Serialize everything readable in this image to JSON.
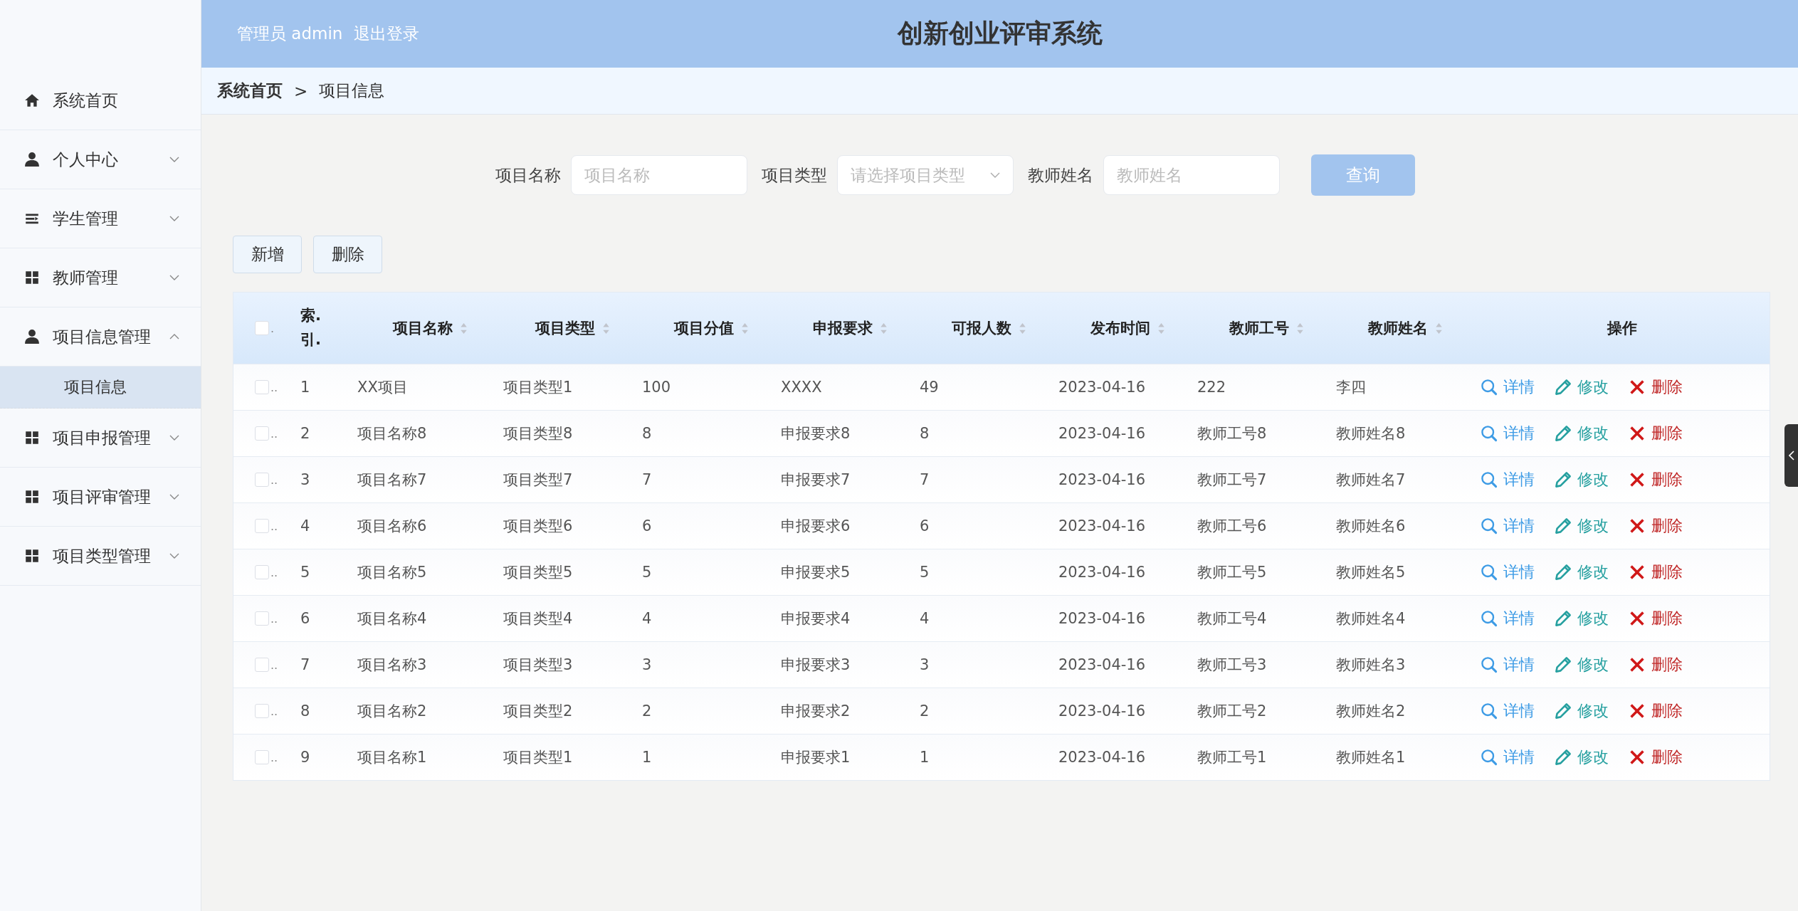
{
  "header": {
    "user_label": "管理员 admin",
    "logout": "退出登录",
    "title": "创新创业评审系统"
  },
  "sidebar": {
    "items": [
      {
        "kind": "home",
        "label": "系统首页"
      },
      {
        "kind": "user",
        "label": "个人中心",
        "expanded": false
      },
      {
        "kind": "list",
        "label": "学生管理",
        "expanded": false
      },
      {
        "kind": "grid",
        "label": "教师管理",
        "expanded": false
      },
      {
        "kind": "user",
        "label": "项目信息管理",
        "expanded": true,
        "children": [
          {
            "label": "项目信息",
            "selected": true
          }
        ]
      },
      {
        "kind": "grid",
        "label": "项目申报管理",
        "expanded": false
      },
      {
        "kind": "grid",
        "label": "项目评审管理",
        "expanded": false
      },
      {
        "kind": "grid",
        "label": "项目类型管理",
        "expanded": false
      }
    ]
  },
  "breadcrumb": {
    "home": "系统首页",
    "separator": ">",
    "current": "项目信息"
  },
  "search": {
    "fields": [
      {
        "kind": "input",
        "label": "项目名称",
        "placeholder": "项目名称"
      },
      {
        "kind": "select",
        "label": "项目类型",
        "placeholder": "请选择项目类型"
      },
      {
        "kind": "input",
        "label": "教师姓名",
        "placeholder": "教师姓名"
      }
    ],
    "button": "查询"
  },
  "actions": [
    "新增",
    "删除"
  ],
  "table": {
    "header_checked": false,
    "header_check_trail": ".",
    "row_check_trail": "..",
    "columns": [
      {
        "label": "索.引.",
        "sortable": false
      },
      {
        "label": "项目名称",
        "sortable": true
      },
      {
        "label": "项目类型",
        "sortable": true
      },
      {
        "label": "项目分值",
        "sortable": true
      },
      {
        "label": "申报要求",
        "sortable": true
      },
      {
        "label": "可报人数",
        "sortable": true
      },
      {
        "label": "发布时间",
        "sortable": true
      },
      {
        "label": "教师工号",
        "sortable": true
      },
      {
        "label": "教师姓名",
        "sortable": true
      },
      {
        "label": "操作",
        "sortable": false
      }
    ],
    "rows": [
      {
        "checked": false,
        "cells": [
          "1",
          "XX项目",
          "项目类型1",
          "100",
          "XXXX",
          "49",
          "2023-04-16",
          "222",
          "李四"
        ],
        "actions": [
          {
            "kind": "detail",
            "label": "详情"
          },
          {
            "kind": "edit",
            "label": "修改"
          },
          {
            "kind": "delete",
            "label": "删除"
          }
        ]
      },
      {
        "checked": false,
        "cells": [
          "2",
          "项目名称8",
          "项目类型8",
          "8",
          "申报要求8",
          "8",
          "2023-04-16",
          "教师工号8",
          "教师姓名8"
        ],
        "actions": [
          {
            "kind": "detail",
            "label": "详情"
          },
          {
            "kind": "edit",
            "label": "修改"
          },
          {
            "kind": "delete",
            "label": "删除"
          }
        ]
      },
      {
        "checked": false,
        "cells": [
          "3",
          "项目名称7",
          "项目类型7",
          "7",
          "申报要求7",
          "7",
          "2023-04-16",
          "教师工号7",
          "教师姓名7"
        ],
        "actions": [
          {
            "kind": "detail",
            "label": "详情"
          },
          {
            "kind": "edit",
            "label": "修改"
          },
          {
            "kind": "delete",
            "label": "删除"
          }
        ]
      },
      {
        "checked": false,
        "cells": [
          "4",
          "项目名称6",
          "项目类型6",
          "6",
          "申报要求6",
          "6",
          "2023-04-16",
          "教师工号6",
          "教师姓名6"
        ],
        "actions": [
          {
            "kind": "detail",
            "label": "详情"
          },
          {
            "kind": "edit",
            "label": "修改"
          },
          {
            "kind": "delete",
            "label": "删除"
          }
        ]
      },
      {
        "checked": false,
        "cells": [
          "5",
          "项目名称5",
          "项目类型5",
          "5",
          "申报要求5",
          "5",
          "2023-04-16",
          "教师工号5",
          "教师姓名5"
        ],
        "actions": [
          {
            "kind": "detail",
            "label": "详情"
          },
          {
            "kind": "edit",
            "label": "修改"
          },
          {
            "kind": "delete",
            "label": "删除"
          }
        ]
      },
      {
        "checked": false,
        "cells": [
          "6",
          "项目名称4",
          "项目类型4",
          "4",
          "申报要求4",
          "4",
          "2023-04-16",
          "教师工号4",
          "教师姓名4"
        ],
        "actions": [
          {
            "kind": "detail",
            "label": "详情"
          },
          {
            "kind": "edit",
            "label": "修改"
          },
          {
            "kind": "delete",
            "label": "删除"
          }
        ]
      },
      {
        "checked": false,
        "cells": [
          "7",
          "项目名称3",
          "项目类型3",
          "3",
          "申报要求3",
          "3",
          "2023-04-16",
          "教师工号3",
          "教师姓名3"
        ],
        "actions": [
          {
            "kind": "detail",
            "label": "详情"
          },
          {
            "kind": "edit",
            "label": "修改"
          },
          {
            "kind": "delete",
            "label": "删除"
          }
        ]
      },
      {
        "checked": false,
        "cells": [
          "8",
          "项目名称2",
          "项目类型2",
          "2",
          "申报要求2",
          "2",
          "2023-04-16",
          "教师工号2",
          "教师姓名2"
        ],
        "actions": [
          {
            "kind": "detail",
            "label": "详情"
          },
          {
            "kind": "edit",
            "label": "修改"
          },
          {
            "kind": "delete",
            "label": "删除"
          }
        ]
      },
      {
        "checked": false,
        "cells": [
          "9",
          "项目名称1",
          "项目类型1",
          "1",
          "申报要求1",
          "1",
          "2023-04-16",
          "教师工号1",
          "教师姓名1"
        ],
        "actions": [
          {
            "kind": "detail",
            "label": "详情"
          },
          {
            "kind": "edit",
            "label": "修改"
          },
          {
            "kind": "delete",
            "label": "删除"
          }
        ]
      }
    ]
  }
}
